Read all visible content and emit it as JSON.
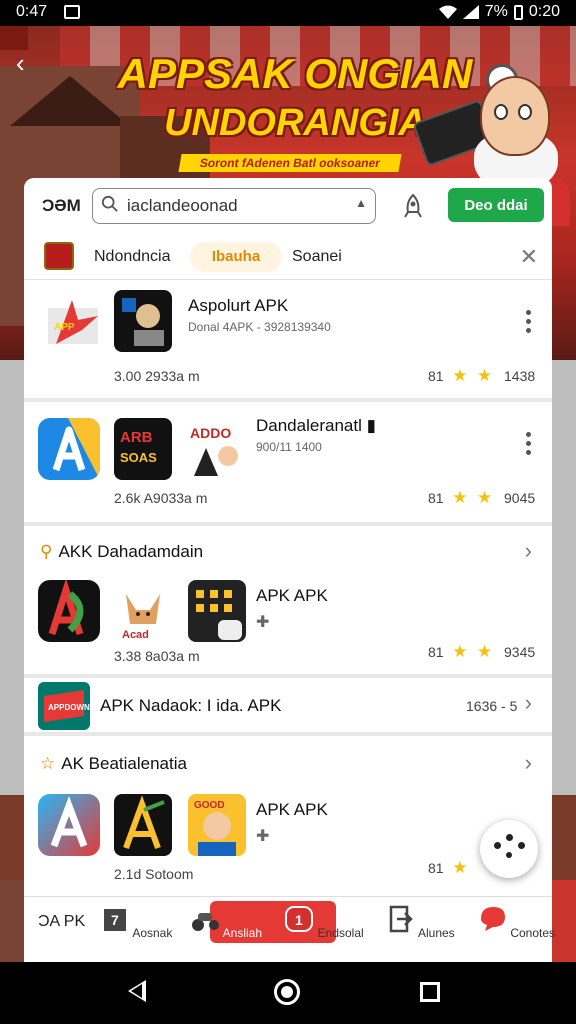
{
  "status_bar": {
    "time": "0:47",
    "battery": "7%",
    "clock": "0:20"
  },
  "banner": {
    "title_line1": "APPSAK ONGIAN",
    "title_line2": "UNDORANGIA",
    "subtitle": "Soront fAdenen Batl ooksoaner"
  },
  "search": {
    "brand": "ƆƏM",
    "query": "iaclandeoonad",
    "button_label": "Deo ddai"
  },
  "tabs": [
    {
      "label": "Ndondncia"
    },
    {
      "label": "Ibauha"
    },
    {
      "label": "Soanei"
    }
  ],
  "apps": [
    {
      "title": "Aspolurt APK",
      "subtitle": "Donal 4APK - 3928139340",
      "meta": "3.00 2933a m",
      "rating": "81",
      "count": "1438"
    },
    {
      "title": "Dandaleranatl ▮",
      "subtitle": "900/11 1400",
      "meta": "2.6k A9033a m",
      "rating": "81",
      "count": "9045"
    }
  ],
  "sections": [
    {
      "title": "AKK Dahadamdain",
      "app_title": "APK APK",
      "meta": "3.38 8a03a m",
      "rating": "81",
      "count": "9345"
    },
    {
      "title": "AK Beatialenatia",
      "app_title": "APK APK",
      "meta": "2.1d Sotoom",
      "rating": "81"
    }
  ],
  "promo_row": {
    "title": "APK Nadaok: I ida. APK",
    "value": "1636 - 5"
  },
  "bottom_nav": {
    "first_label": "ƆA PK",
    "items": [
      {
        "label": "Aosnak"
      },
      {
        "label": "Ansliah"
      },
      {
        "label": "Endsolal"
      },
      {
        "label": "Alunes"
      },
      {
        "label": "Conotes"
      }
    ]
  },
  "colors": {
    "accent_green": "#1ea84a",
    "accent_red": "#e53935",
    "star": "#f4c20d",
    "tab_active": "#e08a00"
  }
}
